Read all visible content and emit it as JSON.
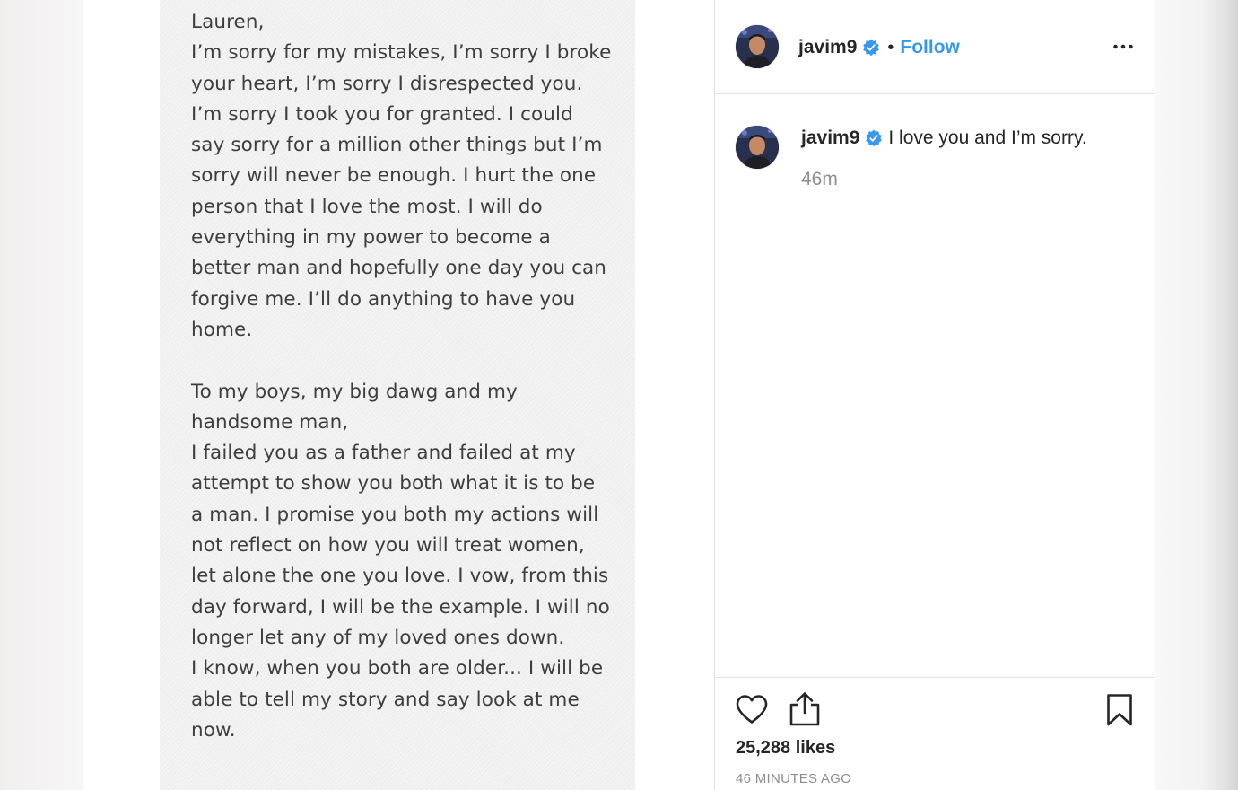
{
  "post": {
    "note_text": "Lauren,\nI’m sorry for my mistakes, I’m sorry I broke\nyour heart,  I’m sorry I disrespected you.\nI’m sorry I took you for granted. I could\nsay sorry for a million other things but I’m\nsorry will never be enough. I hurt the one\nperson that I love the most. I will do\neverything in my power to become a\nbetter man and hopefully one day you can\nforgive me. I’ll do anything to have you\nhome.\n\nTo my boys, my big dawg and my\nhandsome man,\nI failed you as a father and failed at my\nattempt to show you both what it is to be\na man. I promise you both my actions will\nnot reflect on how you will treat women,\nlet alone the one you love. I vow, from this\nday forward, I will be the example. I will no\nlonger let any of my loved ones down.\nI know, when you both are older... I will be\nable to tell my story and say look at me\nnow."
  },
  "header": {
    "username": "javim9",
    "separator": "•",
    "follow_label": "Follow"
  },
  "comment": {
    "username": "javim9",
    "caption": "I love you and I’m sorry.",
    "time": "46m"
  },
  "footer": {
    "likes": "25,288 likes",
    "timestamp": "46 MINUTES AGO"
  },
  "icons": {
    "verified": "verified-badge-icon",
    "more": "more-options-icon",
    "like": "heart-icon",
    "share": "share-icon",
    "save": "bookmark-icon"
  },
  "colors": {
    "link": "#3897f0",
    "text": "#262626",
    "muted": "#8e8e8e",
    "verified": "#3897f0"
  }
}
